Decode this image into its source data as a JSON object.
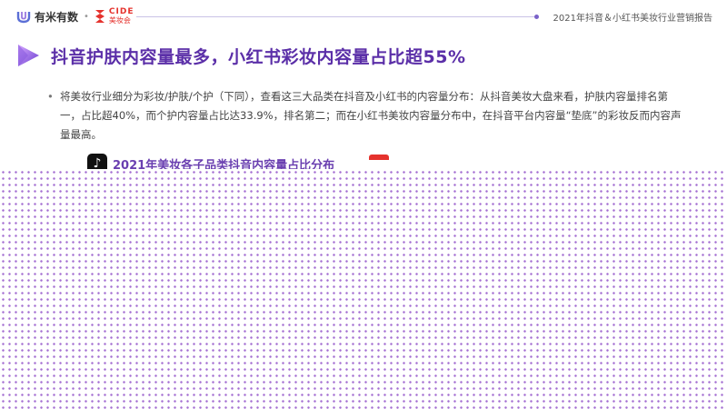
{
  "header": {
    "brand_name": "有米有数",
    "separator": "•",
    "partner_logo_en": "CIDE",
    "partner_logo_cn": "美妆会",
    "report_title": "2021年抖音＆小红书美妆行业营销报告"
  },
  "slide": {
    "title": "抖音护肤内容量最多，小红书彩妆内容量占比超55%",
    "bullet_text": "将美妆行业细分为彩妆/护肤/个护（下同），查看这三大品类在抖音及小红书的内容量分布：从抖音美妆大盘来看，护肤内容量排名第一，占比超40%，而个护内容量占比达33.9%，排名第二；而在小红书美妆内容量分布中，在抖音平台内容量“垫底”的彩妆反而内容声量最高。",
    "bullet_mark": "•",
    "subchart_title": "2021年美妆各子品类抖音内容量占比分布"
  },
  "colors": {
    "title_purple": "#5b2fa8",
    "dot_pattern": "#a36ed1",
    "accent_red": "#e5322d"
  },
  "icons": {
    "brand_logo": "youmi-logo-icon",
    "section_marker": "triangle-play-icon",
    "platform": "tiktok-icon"
  }
}
